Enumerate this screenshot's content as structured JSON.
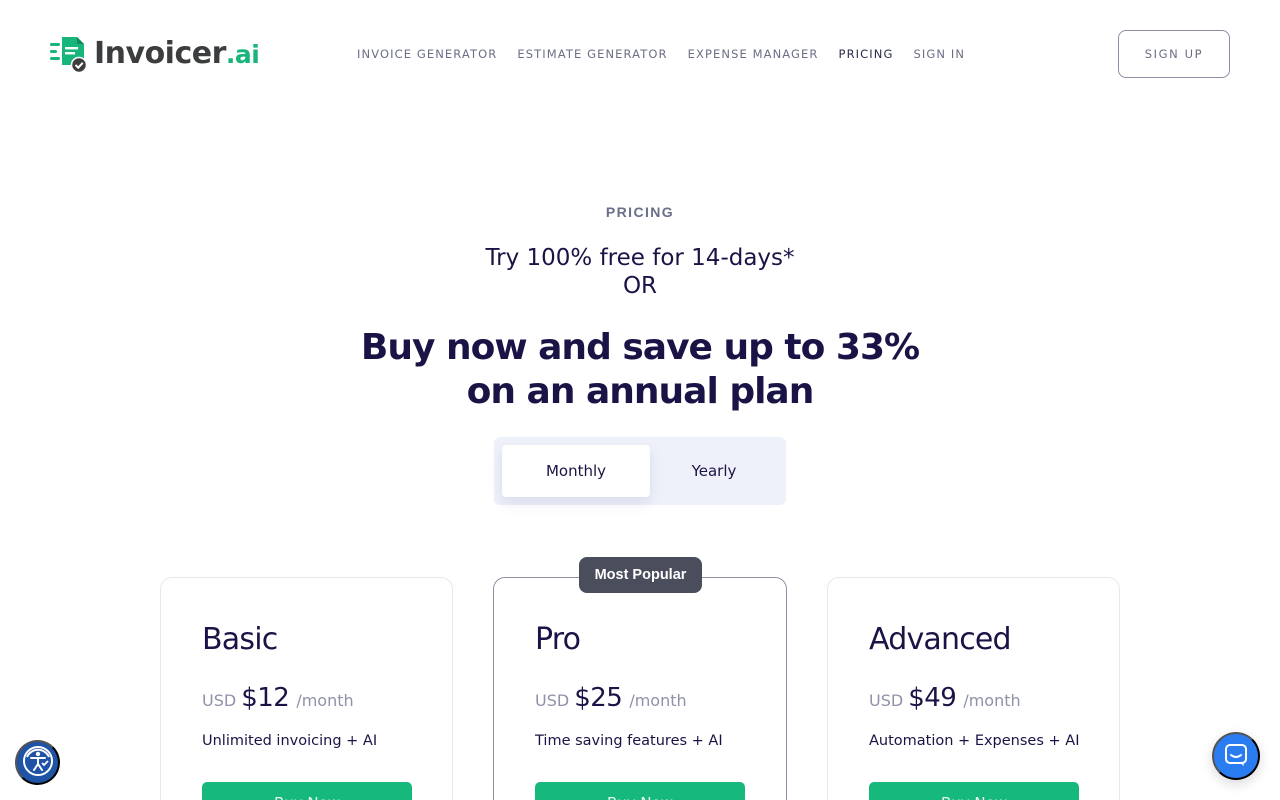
{
  "brand": {
    "name": "Invoicer",
    "suffix": ".ai",
    "color": "#18b57b"
  },
  "nav": {
    "items": [
      {
        "label": "INVOICE GENERATOR"
      },
      {
        "label": "ESTIMATE GENERATOR"
      },
      {
        "label": "EXPENSE MANAGER"
      },
      {
        "label": "PRICING",
        "active": true
      },
      {
        "label": "SIGN IN"
      }
    ],
    "signup_label": "SIGN UP"
  },
  "hero": {
    "eyebrow": "PRICING",
    "trial_line": "Try 100% free for 14-days*",
    "or_line": "OR",
    "headline": "Buy now and save up to 33% on an annual plan"
  },
  "billing_toggle": {
    "options": [
      {
        "label": "Monthly",
        "selected": true
      },
      {
        "label": "Yearly",
        "selected": false
      }
    ]
  },
  "plans": [
    {
      "name": "Basic",
      "currency": "USD",
      "amount": "$12",
      "period": "/month",
      "description": "Unlimited invoicing + AI",
      "button": "Buy Now"
    },
    {
      "name": "Pro",
      "currency": "USD",
      "amount": "$25",
      "period": "/month",
      "description": "Time saving features + AI",
      "button": "Buy Now",
      "badge": "Most Popular"
    },
    {
      "name": "Advanced",
      "currency": "USD",
      "amount": "$49",
      "period": "/month",
      "description": "Automation + Expenses + AI",
      "button": "Buy Now"
    }
  ],
  "widgets": {
    "accessibility_icon": "accessibility-icon",
    "chat_icon": "chat-icon"
  }
}
